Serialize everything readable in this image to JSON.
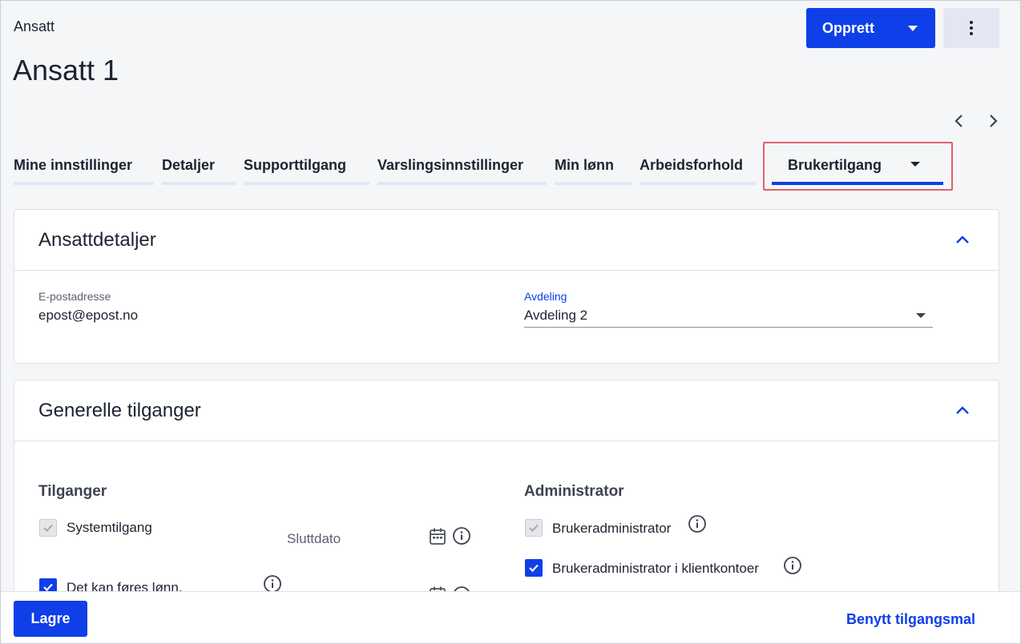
{
  "header": {
    "breadcrumb": "Ansatt",
    "title": "Ansatt 1",
    "create_label": "Opprett"
  },
  "tabs": [
    {
      "label": "Mine innstillinger",
      "active": false
    },
    {
      "label": "Detaljer",
      "active": false
    },
    {
      "label": "Supporttilgang",
      "active": false
    },
    {
      "label": "Varslingsinnstillinger",
      "active": false
    },
    {
      "label": "Min lønn",
      "active": false
    },
    {
      "label": "Arbeidsforhold",
      "active": false
    },
    {
      "label": "Brukertilgang",
      "active": true
    }
  ],
  "employee_details": {
    "title": "Ansattdetaljer",
    "email_label": "E-postadresse",
    "email_value": "epost@epost.no",
    "department_label": "Avdeling",
    "department_value": "Avdeling 2"
  },
  "general_access": {
    "title": "Generelle tilganger",
    "access_heading": "Tilganger",
    "admin_heading": "Administrator",
    "system_access_label": "Systemtilgang",
    "end_date_label": "Sluttdato",
    "payroll_label": "Det kan føres lønn.",
    "user_admin_label": "Brukeradministrator",
    "client_admin_label": "Brukeradministrator i klientkontoer"
  },
  "footer": {
    "save_label": "Lagre",
    "apply_template_label": "Benytt tilgangsmal"
  },
  "colors": {
    "primary": "#0f3fe8",
    "highlight": "#e0616b",
    "tab_inactive_bar": "#e3e7f3"
  }
}
